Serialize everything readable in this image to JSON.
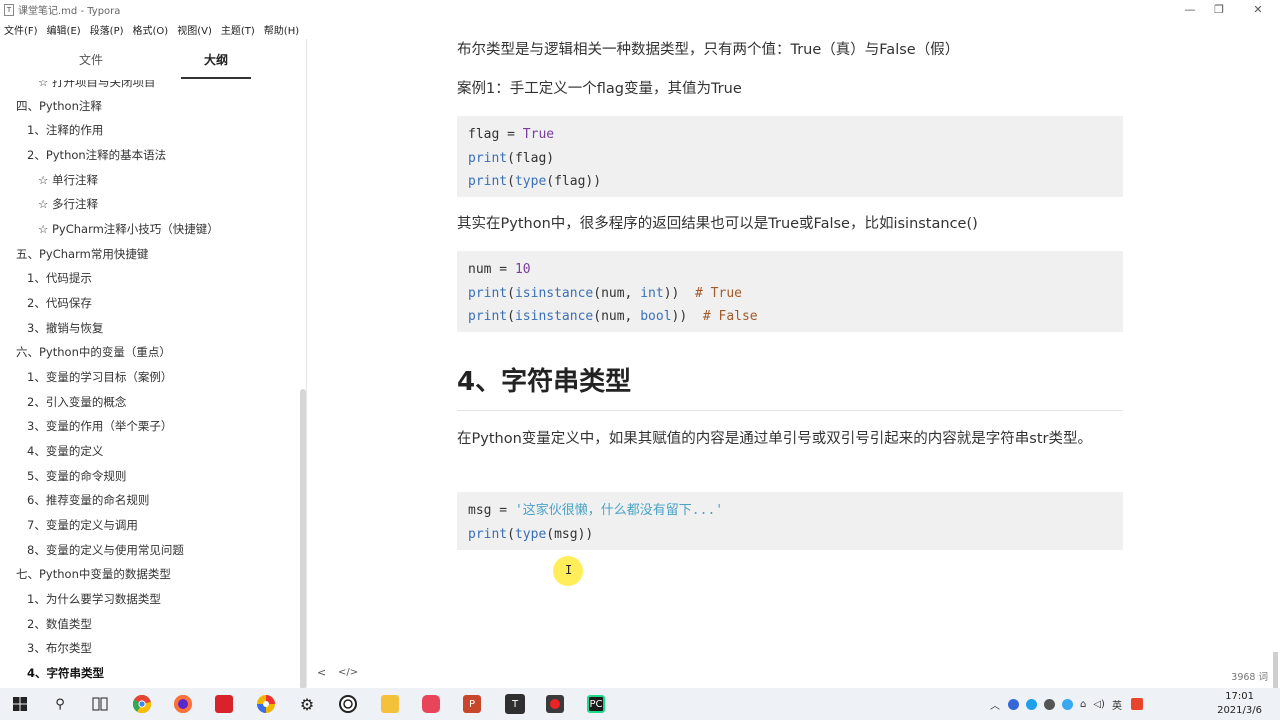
{
  "window": {
    "title": "课堂笔记.md - Typora",
    "app_icon": "T",
    "controls": [
      "—",
      "❐",
      "✕"
    ]
  },
  "menu": [
    "文件(F)",
    "编辑(E)",
    "段落(P)",
    "格式(O)",
    "视图(V)",
    "主题(T)",
    "帮助(H)"
  ],
  "sidebar": {
    "tabs": [
      "文件",
      "大纲"
    ],
    "active_tab": "大纲",
    "outline": [
      {
        "label": "☆ 打开项目与关闭项目",
        "level": 3
      },
      {
        "label": "四、Python注释",
        "level": 1
      },
      {
        "label": "1、注释的作用",
        "level": 2
      },
      {
        "label": "2、Python注释的基本语法",
        "level": 2
      },
      {
        "label": "☆ 单行注释",
        "level": 3
      },
      {
        "label": "☆ 多行注释",
        "level": 3
      },
      {
        "label": "☆ PyCharm注释小技巧（快捷键）",
        "level": 3
      },
      {
        "label": "五、PyCharm常用快捷键",
        "level": 1
      },
      {
        "label": "1、代码提示",
        "level": 2
      },
      {
        "label": "2、代码保存",
        "level": 2
      },
      {
        "label": "3、撤销与恢复",
        "level": 2
      },
      {
        "label": "六、Python中的变量（重点）",
        "level": 1
      },
      {
        "label": "1、变量的学习目标（案例）",
        "level": 2
      },
      {
        "label": "2、引入变量的概念",
        "level": 2
      },
      {
        "label": "3、变量的作用（举个栗子）",
        "level": 2
      },
      {
        "label": "4、变量的定义",
        "level": 2
      },
      {
        "label": "5、变量的命令规则",
        "level": 2
      },
      {
        "label": "6、推荐变量的命名规则",
        "level": 2
      },
      {
        "label": "7、变量的定义与调用",
        "level": 2
      },
      {
        "label": "8、变量的定义与使用常见问题",
        "level": 2
      },
      {
        "label": "七、Python中变量的数据类型",
        "level": 1
      },
      {
        "label": "1、为什么要学习数据类型",
        "level": 2
      },
      {
        "label": "2、数值类型",
        "level": 2
      },
      {
        "label": "3、布尔类型",
        "level": 2
      },
      {
        "label": "4、字符串类型",
        "level": 2,
        "active": true
      }
    ]
  },
  "content": {
    "p1": "布尔类型是与逻辑相关一种数据类型，只有两个值：True（真）与False（假）",
    "p2": "案例1：手工定义一个flag变量，其值为True",
    "code1": {
      "l1a": "flag",
      "l1b": " = ",
      "l1c": "True",
      "l2a": "print",
      "l2b": "(flag)",
      "l3a": "print",
      "l3b": "(",
      "l3c": "type",
      "l3d": "(flag))"
    },
    "p3": "其实在Python中，很多程序的返回结果也可以是True或False，比如isinstance()",
    "code2": {
      "l1a": "num",
      "l1b": " = ",
      "l1c": "10",
      "l2a": "print",
      "l2b": "(",
      "l2c": "isinstance",
      "l2d": "(num, ",
      "l2e": "int",
      "l2f": "))  ",
      "l2g": "# True",
      "l3a": "print",
      "l3b": "(",
      "l3c": "isinstance",
      "l3d": "(num, ",
      "l3e": "bool",
      "l3f": "))  ",
      "l3g": "# False"
    },
    "heading": "4、字符串类型",
    "p4": "在Python变量定义中，如果其赋值的内容是通过单引号或双引号引起来的内容就是字符串str类型。",
    "code3": {
      "l1a": "msg",
      "l1b": " = ",
      "l1c": "'这家伙很懒，什么都没有留下...'",
      "l2a": "print",
      "l2b": "(",
      "l2c": "type",
      "l2d": "(msg))"
    }
  },
  "footer": {
    "back": "<",
    "source": "</>",
    "word_count": "3968 词"
  },
  "taskbar": {
    "tray_lang": "英",
    "time": "17:01",
    "date": "2021/3/6"
  }
}
